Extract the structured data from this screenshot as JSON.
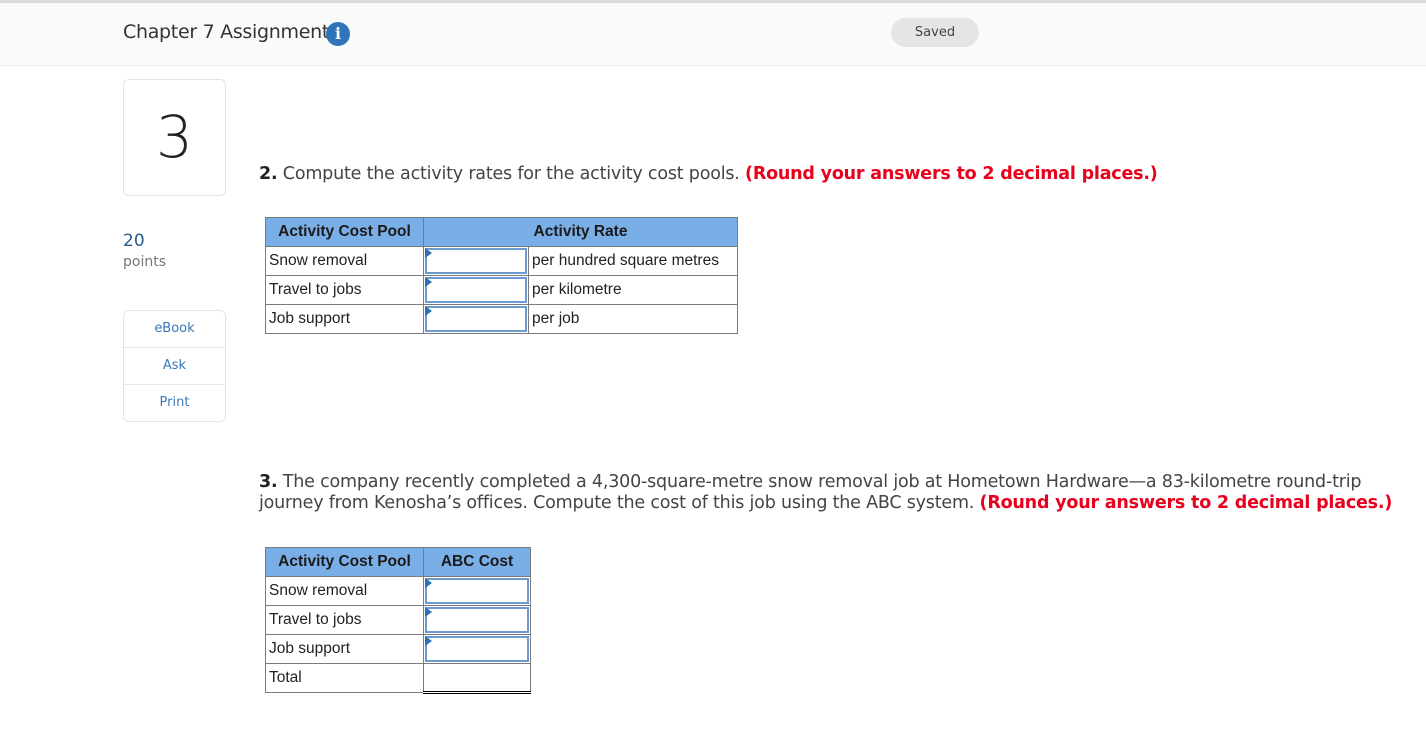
{
  "header": {
    "title": "Chapter 7 Assignment",
    "info_icon": "info-icon",
    "status": "Saved"
  },
  "sidebar": {
    "question_number": "3",
    "points_value": "20",
    "points_label": "points",
    "tools": [
      {
        "label": "eBook"
      },
      {
        "label": "Ask"
      },
      {
        "label": "Print"
      }
    ]
  },
  "part2": {
    "number": "2.",
    "text": " Compute the activity rates for the activity cost pools. ",
    "instruction": "(Round your answers to 2 decimal places.)",
    "table": {
      "headers": [
        "Activity Cost Pool",
        "Activity Rate"
      ],
      "rows": [
        {
          "pool": "Snow removal",
          "value": "",
          "unit": "per hundred square metres"
        },
        {
          "pool": "Travel to jobs",
          "value": "",
          "unit": "per kilometre"
        },
        {
          "pool": "Job support",
          "value": "",
          "unit": "per job"
        }
      ]
    }
  },
  "part3": {
    "number": "3.",
    "text_line1": " The company recently completed a 4,300-square-metre snow removal job at Hometown Hardware—a 83-kilometre round-trip",
    "text_line2": "journey from Kenosha’s offices. Compute the cost of this job using the ABC system. ",
    "instruction": "(Round your answers to 2 decimal places.)",
    "table": {
      "headers": [
        "Activity Cost Pool",
        "ABC Cost"
      ],
      "rows": [
        {
          "pool": "Snow removal",
          "value": ""
        },
        {
          "pool": "Travel to jobs",
          "value": ""
        },
        {
          "pool": "Job support",
          "value": ""
        }
      ],
      "total_label": "Total",
      "total_value": ""
    }
  }
}
